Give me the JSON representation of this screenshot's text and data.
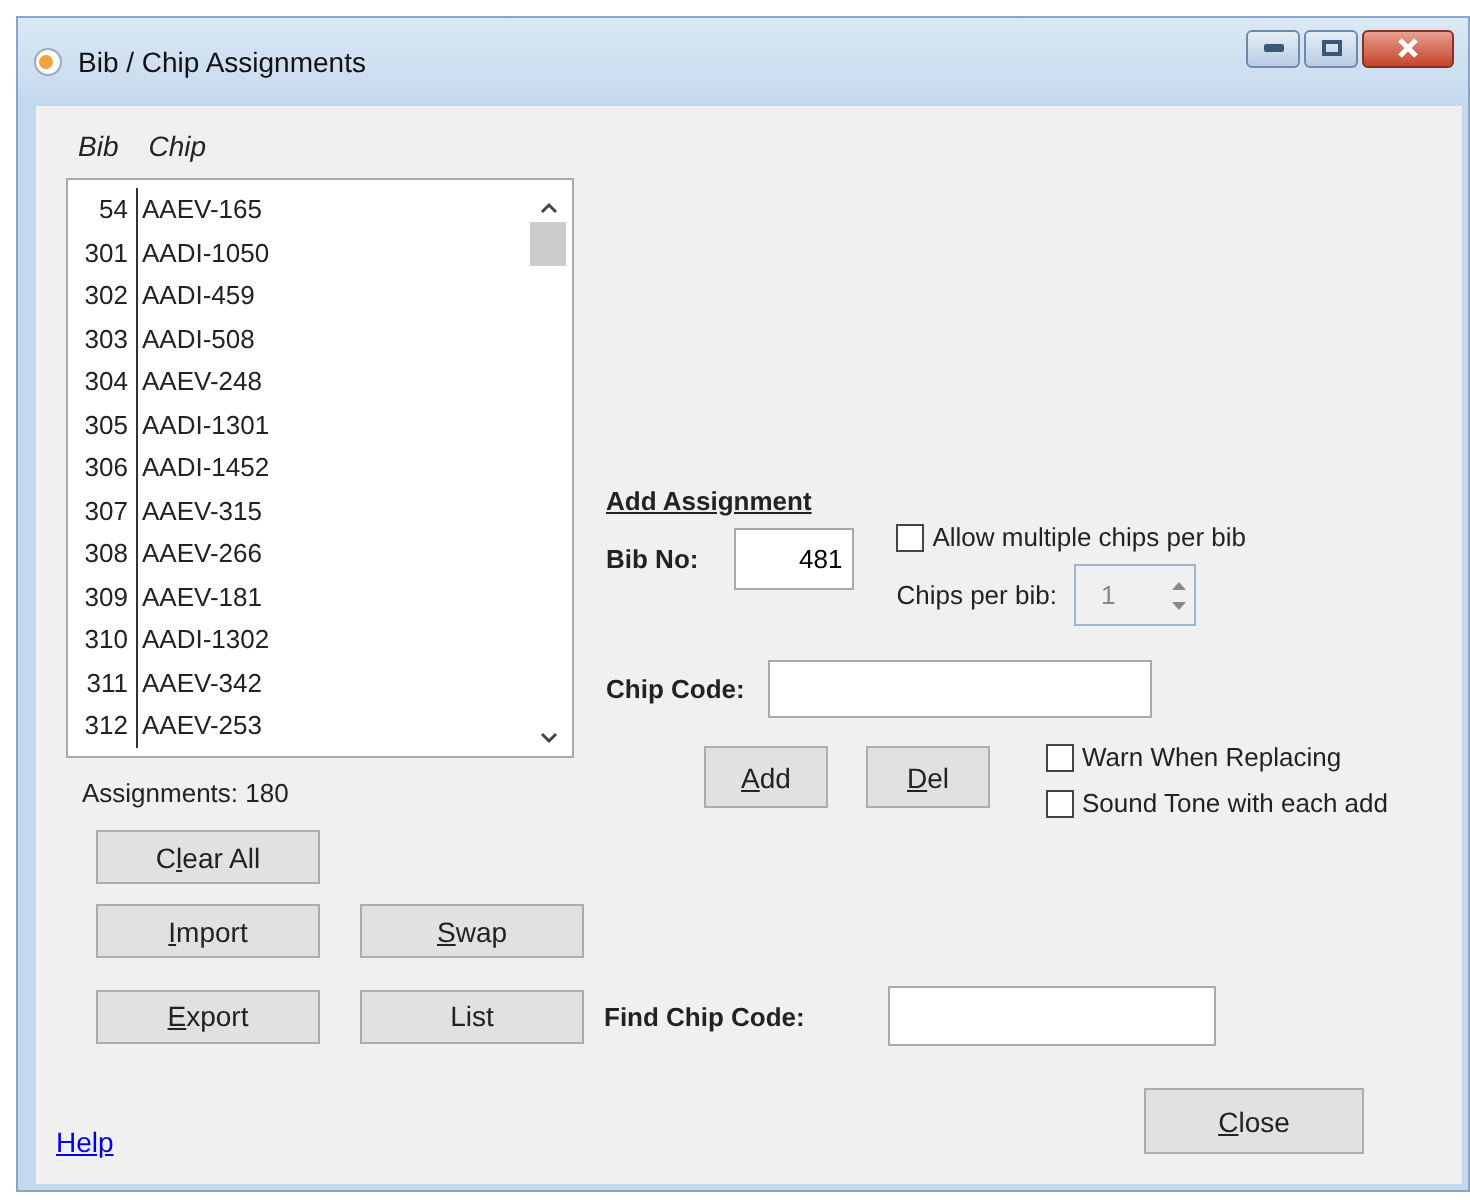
{
  "window": {
    "title": "Bib / Chip Assignments"
  },
  "list": {
    "columns": [
      "Bib",
      "Chip"
    ],
    "rows": [
      {
        "bib": "54",
        "chip": "AAEV-165"
      },
      {
        "bib": "301",
        "chip": "AADI-1050"
      },
      {
        "bib": "302",
        "chip": "AADI-459"
      },
      {
        "bib": "303",
        "chip": "AADI-508"
      },
      {
        "bib": "304",
        "chip": "AAEV-248"
      },
      {
        "bib": "305",
        "chip": "AADI-1301"
      },
      {
        "bib": "306",
        "chip": "AADI-1452"
      },
      {
        "bib": "307",
        "chip": "AAEV-315"
      },
      {
        "bib": "308",
        "chip": "AAEV-266"
      },
      {
        "bib": "309",
        "chip": "AAEV-181"
      },
      {
        "bib": "310",
        "chip": "AADI-1302"
      },
      {
        "bib": "311",
        "chip": "AAEV-342"
      },
      {
        "bib": "312",
        "chip": "AAEV-253"
      }
    ]
  },
  "assignments_count": "Assignments: 180",
  "add_assignment": {
    "heading": "Add Assignment",
    "bib_label": "Bib No:",
    "bib_value": "481",
    "allow_multiple": {
      "label": "Allow multiple chips per bib",
      "checked": false
    },
    "chips_per_bib": {
      "label": "Chips per bib:",
      "value": "1",
      "disabled": true
    },
    "chip_code_label": "Chip Code:",
    "add": {
      "label": [
        {
          "text": "A",
          "access_key": true
        },
        {
          "text": "dd",
          "access_key": false
        }
      ]
    },
    "del": {
      "label": [
        {
          "text": "D",
          "access_key": true
        },
        {
          "text": "el",
          "access_key": false
        }
      ]
    },
    "warn_replacing": {
      "label": "Warn When Replacing",
      "checked": false
    },
    "sound_tone": {
      "label": "Sound Tone with each add",
      "checked": false
    }
  },
  "buttons": {
    "clear_all": {
      "label": [
        {
          "text": "C",
          "access_key": false
        },
        {
          "text": "l",
          "access_key": true
        },
        {
          "text": "ear All",
          "access_key": false
        }
      ]
    },
    "import": {
      "label": [
        {
          "text": "I",
          "access_key": true
        },
        {
          "text": "mport",
          "access_key": false
        }
      ]
    },
    "swap": {
      "label": [
        {
          "text": "S",
          "access_key": true
        },
        {
          "text": "wap",
          "access_key": false
        }
      ]
    },
    "export": {
      "label": [
        {
          "text": "E",
          "access_key": true
        },
        {
          "text": "xport",
          "access_key": false
        }
      ]
    },
    "list": {
      "label": [
        {
          "text": "List",
          "access_key": false
        }
      ]
    },
    "close": {
      "label": [
        {
          "text": "C",
          "access_key": true
        },
        {
          "text": "lose",
          "access_key": false
        }
      ]
    }
  },
  "find": {
    "label": "Find Chip Code:"
  },
  "help_link": "Help"
}
